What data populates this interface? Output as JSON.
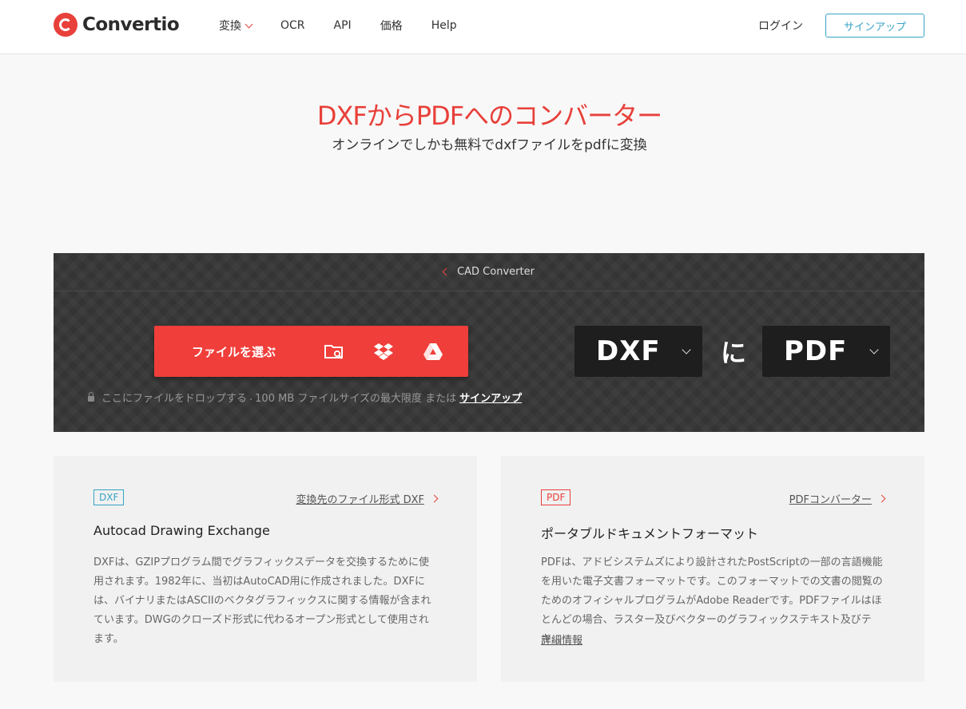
{
  "header": {
    "logo_text": "Convertio",
    "nav": [
      "変換",
      "OCR",
      "API",
      "価格",
      "Help"
    ],
    "login": "ログイン",
    "signup": "サインアップ"
  },
  "hero": {
    "title": "DXFからPDFへのコンバーター",
    "subtitle": "オンラインでしかも無料でdxfファイルをpdfに変換"
  },
  "converter": {
    "breadcrumb": "CAD Converter",
    "choose_label": "ファイルを選ぶ",
    "icons": [
      "folder-search-icon",
      "dropbox-icon",
      "google-drive-icon"
    ],
    "drop_text": "ここにファイルをドロップする",
    "size_text": "100 MB ファイルサイズの最大限度 または",
    "drop_link": "サインアップ",
    "from_format": "DXF",
    "to_word": "に",
    "to_format": "PDF"
  },
  "cards": [
    {
      "badge": "DXF",
      "badge_color": "#36a3c4",
      "link": "変換先のファイル形式 DXF",
      "title": "Autocad Drawing Exchange",
      "desc": "DXFは、GZIPプログラム間でグラフィックスデータを交換するために使用されます。1982年に、当初はAutoCAD用に作成されました。DXFには、バイナリまたはASCIIのベクタグラフィックスに関する情報が含まれています。DWGのクローズド形式に代わるオープン形式として使用されます。"
    },
    {
      "badge": "PDF",
      "badge_color": "#e8403a",
      "link": "PDFコンバーター",
      "title": "ポータブルドキュメントフォーマット",
      "desc": "PDFは、アドビシステムズにより設計されたPostScriptの一部の言語機能を用いた電子文書フォーマットです。このフォーマットでの文書の閲覧のためのオフィシャルプログラムがAdobe Readerです。PDFファイルはほとんどの場合、ラスター及びベクターのグラフィックステキスト及びテキ...",
      "more": "詳細情報"
    }
  ],
  "colors": {
    "accent": "#e8403a",
    "link_blue": "#36a3c4",
    "dark_panel": "#343434"
  }
}
